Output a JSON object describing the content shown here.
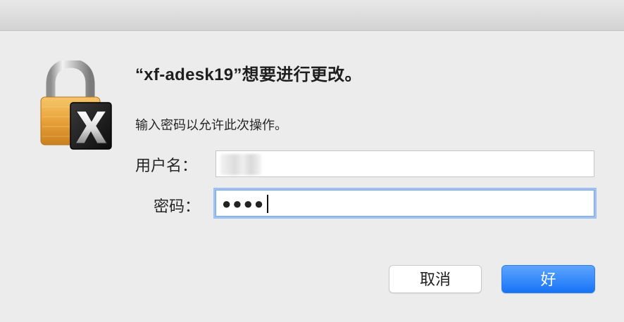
{
  "dialog": {
    "title": "“xf-adesk19”想要进行更改。",
    "subtitle": "输入密码以允许此次操作。",
    "icon": "lock-with-x-icon"
  },
  "form": {
    "username_label": "用户名：",
    "username_value": "",
    "password_label": "密码：",
    "password_mask": "●●●●"
  },
  "buttons": {
    "cancel_label": "取消",
    "ok_label": "好"
  },
  "colors": {
    "ok_button": "#1774f5",
    "focus_ring": "#9dc1f2"
  }
}
